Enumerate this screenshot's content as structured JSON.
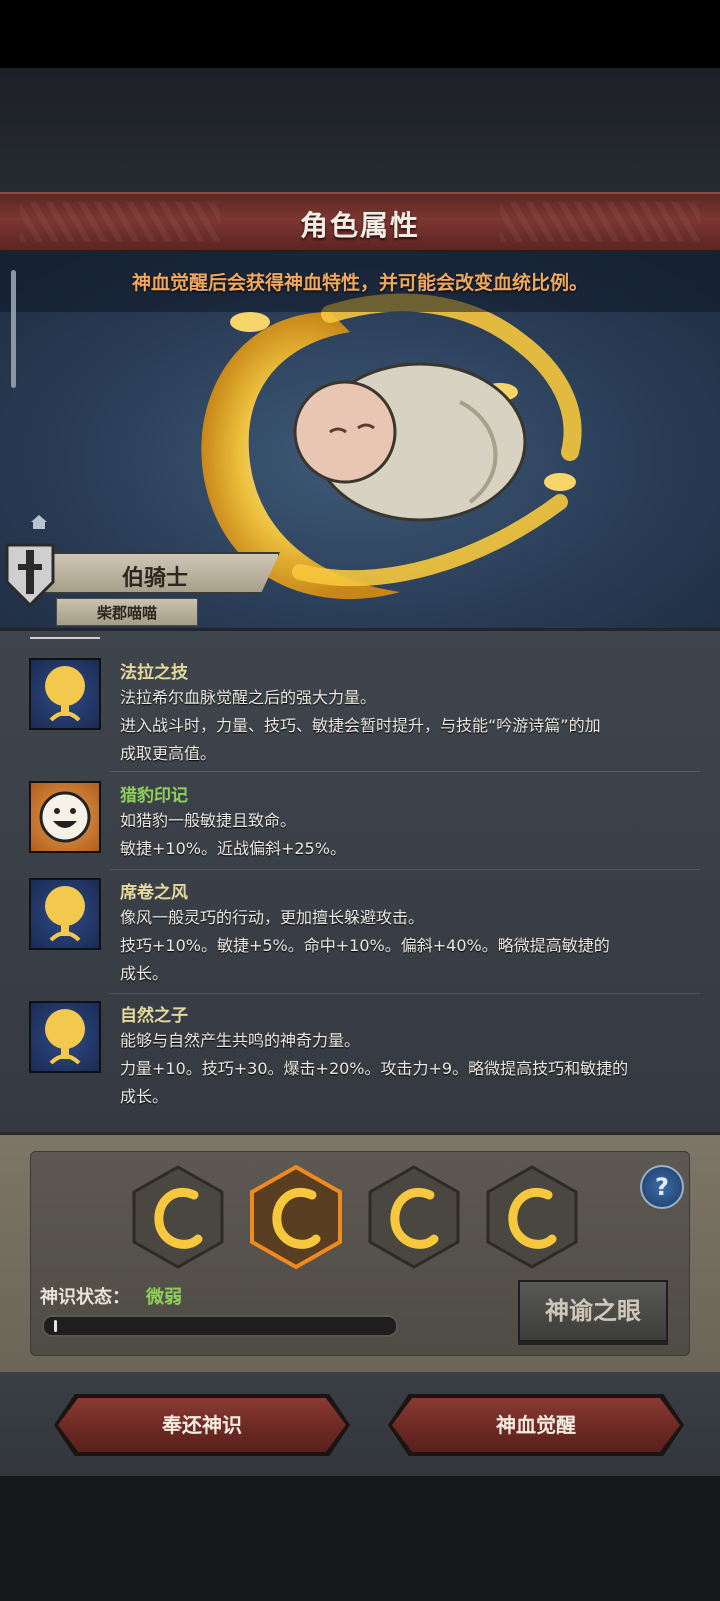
{
  "title": "角色属性",
  "hint": "神血觉醒后会获得神血特性，并可能会改变血统比例。",
  "character": {
    "rank": "伯骑士",
    "name": "柴郡喵喵"
  },
  "skills": [
    {
      "name": "法拉之技",
      "icon": "golden-tree-icon",
      "lines": [
        "法拉希尔血脉觉醒之后的强大力量。",
        "进入战斗时，力量、技巧、敏捷会暂时提升，与技能“吟游诗篇”的加",
        "成取更高值。"
      ]
    },
    {
      "name": "猎豹印记",
      "icon": "smiley-face-icon",
      "lines": [
        "如猎豹一般敏捷且致命。",
        "敏捷+10%。近战偏斜+25%。"
      ]
    },
    {
      "name": "席卷之风",
      "icon": "golden-tree-icon",
      "lines": [
        "像风一般灵巧的行动，更加擅长躲避攻击。",
        "技巧+10%。敏捷+5%。命中+10%。偏斜+40%。略微提高敏捷的",
        "成长。"
      ]
    },
    {
      "name": "自然之子",
      "icon": "golden-tree-icon",
      "lines": [
        "能够与自然产生共鸣的神奇力量。",
        "力量+10。技巧+30。爆击+20%。攻击力+9。略微提高技巧和敏捷的",
        "成长。"
      ]
    }
  ],
  "divine": {
    "state_label": "神识状态：",
    "state_value": "微弱",
    "progress": 0.01,
    "oracle_button": "神谕之眼",
    "help": "?"
  },
  "actions": {
    "return_label": "奉还神识",
    "awaken_label": "神血觉醒"
  },
  "colors": {
    "banner": "#7d3630",
    "accent_orange": "#f0a85e",
    "skill_name_yellow": "#e4d89a",
    "status_green": "#8fd05a"
  }
}
